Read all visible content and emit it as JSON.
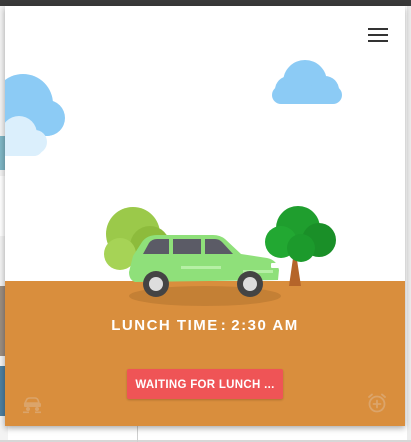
{
  "header": {
    "menu_icon": "hamburger-menu-icon"
  },
  "scene": {
    "sky_color": "#ffffff",
    "ground_color": "#d98e3d",
    "car_color": "#8fe07a",
    "cloud_color": "#8ccbf5"
  },
  "schedule": {
    "label": "LUNCH TIME",
    "separator": ":",
    "time": "2:30 AM"
  },
  "actions": {
    "status_button_label": "WAITING FOR LUNCH ...",
    "status_button_color": "#ef5456",
    "settings_icon": "car-settings-icon",
    "alarm_icon": "add-alarm-icon"
  }
}
